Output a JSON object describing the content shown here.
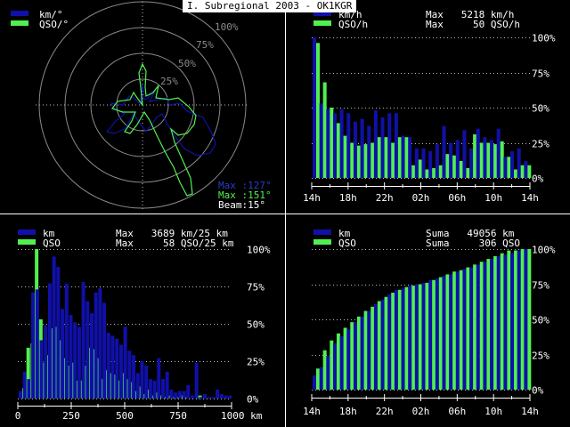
{
  "title": "I. Subregional 2003 - OK1KGR",
  "colors": {
    "blue": "#1010a8",
    "green": "#50f050",
    "white": "#ffffff",
    "grid": "#8a8a8a"
  },
  "polar": {
    "legend": [
      {
        "label": "km/°",
        "color": "#1010a8"
      },
      {
        "label": "QSO/°",
        "color": "#50f050"
      }
    ],
    "ring_labels": [
      "25%",
      "50%",
      "75%",
      "100%"
    ],
    "max_km_text": "Max :127°",
    "max_qso_text": "Max :151°",
    "beam_text": "Beam:15°"
  },
  "chart_data": [
    {
      "id": "hourly",
      "type": "bar",
      "legend": [
        {
          "label": "km/h",
          "color": "#1010a8"
        },
        {
          "label": "QSO/h",
          "color": "#50f050"
        }
      ],
      "max_km_text": "Max   5218 km/h",
      "max_qso_text": "Max     50 QSO/h",
      "y_tick_labels": [
        "100%",
        "75%",
        "50%",
        "25%",
        "0%"
      ],
      "x_tick_labels": [
        "14h",
        "18h",
        "22h",
        "02h",
        "06h",
        "10h",
        "14h"
      ],
      "ylim": [
        0,
        100
      ],
      "series": [
        {
          "name": "km/h",
          "values": [
            100,
            53,
            49,
            46,
            49,
            46,
            40,
            42,
            37,
            48,
            43,
            46,
            46,
            30,
            29,
            21,
            21,
            19,
            24,
            37,
            25,
            27,
            34,
            21,
            35,
            29,
            27,
            35,
            15,
            19,
            21,
            12
          ]
        },
        {
          "name": "QSO/h",
          "values": [
            96,
            68,
            50,
            39,
            30,
            25,
            23,
            24,
            25,
            29,
            29,
            25,
            29,
            29,
            9,
            13,
            6,
            7,
            9,
            17,
            16,
            12,
            7,
            31,
            25,
            25,
            24,
            26,
            15,
            6,
            9,
            9
          ]
        }
      ]
    },
    {
      "id": "distance",
      "type": "bar",
      "legend": [
        {
          "label": "km",
          "color": "#1010a8"
        },
        {
          "label": "QSO",
          "color": "#50f050"
        }
      ],
      "max_km_text": "Max   3689 km/25 km",
      "max_qso_text": "Max     58 QSO/25 km",
      "y_tick_labels": [
        "100%",
        "75%",
        "50%",
        "25%",
        "0%"
      ],
      "x_tick_labels": [
        "0",
        "250",
        "500",
        "750",
        "1000 km"
      ],
      "xlim": [
        0,
        1000
      ],
      "ylim": [
        0,
        100
      ],
      "series": [
        {
          "name": "km",
          "values": [
            5,
            18,
            13,
            71,
            73,
            39,
            49,
            77,
            95,
            88,
            60,
            77,
            56,
            51,
            48,
            78,
            65,
            57,
            71,
            74,
            64,
            44,
            42,
            40,
            36,
            48,
            32,
            29,
            17,
            25,
            22,
            13,
            12,
            27,
            13,
            18,
            6,
            4,
            5,
            5,
            9,
            2,
            24,
            1,
            3,
            1,
            1,
            6,
            3,
            2,
            2
          ]
        },
        {
          "name": "QSO",
          "values": [
            7,
            34,
            37,
            100,
            53,
            24,
            29,
            47,
            48,
            39,
            27,
            22,
            24,
            12,
            12,
            22,
            34,
            33,
            27,
            13,
            19,
            17,
            16,
            12,
            17,
            13,
            11,
            5,
            8,
            3,
            6,
            2,
            4,
            2,
            1,
            2,
            1,
            1,
            2,
            1,
            0,
            0,
            2,
            0,
            0,
            0,
            0,
            0,
            0,
            0,
            0
          ]
        }
      ]
    },
    {
      "id": "cumulative",
      "type": "bar",
      "legend": [
        {
          "label": "km",
          "color": "#1010a8"
        },
        {
          "label": "QSO",
          "color": "#50f050"
        }
      ],
      "max_km_text": "Suma   49056 km",
      "max_qso_text": "Suma     306 QSO",
      "y_tick_labels": [
        "100%",
        "75%",
        "50%",
        "25%",
        "0%"
      ],
      "x_tick_labels": [
        "14h",
        "18h",
        "22h",
        "02h",
        "06h",
        "10h",
        "14h"
      ],
      "ylim": [
        0,
        100
      ],
      "series": [
        {
          "name": "km",
          "values": [
            10,
            16,
            24,
            33,
            38,
            43,
            48,
            52,
            56,
            61,
            64,
            68,
            71,
            72,
            74,
            75,
            76,
            78,
            79,
            81,
            82,
            84,
            86,
            87,
            89,
            91,
            93,
            95,
            96,
            97,
            99,
            100
          ]
        },
        {
          "name": "QSO",
          "values": [
            15,
            28,
            35,
            40,
            44,
            48,
            52,
            56,
            59,
            63,
            66,
            69,
            71,
            73,
            74,
            75,
            76,
            78,
            80,
            82,
            84,
            85,
            87,
            89,
            91,
            93,
            95,
            97,
            99,
            99,
            100,
            100
          ]
        }
      ]
    }
  ]
}
